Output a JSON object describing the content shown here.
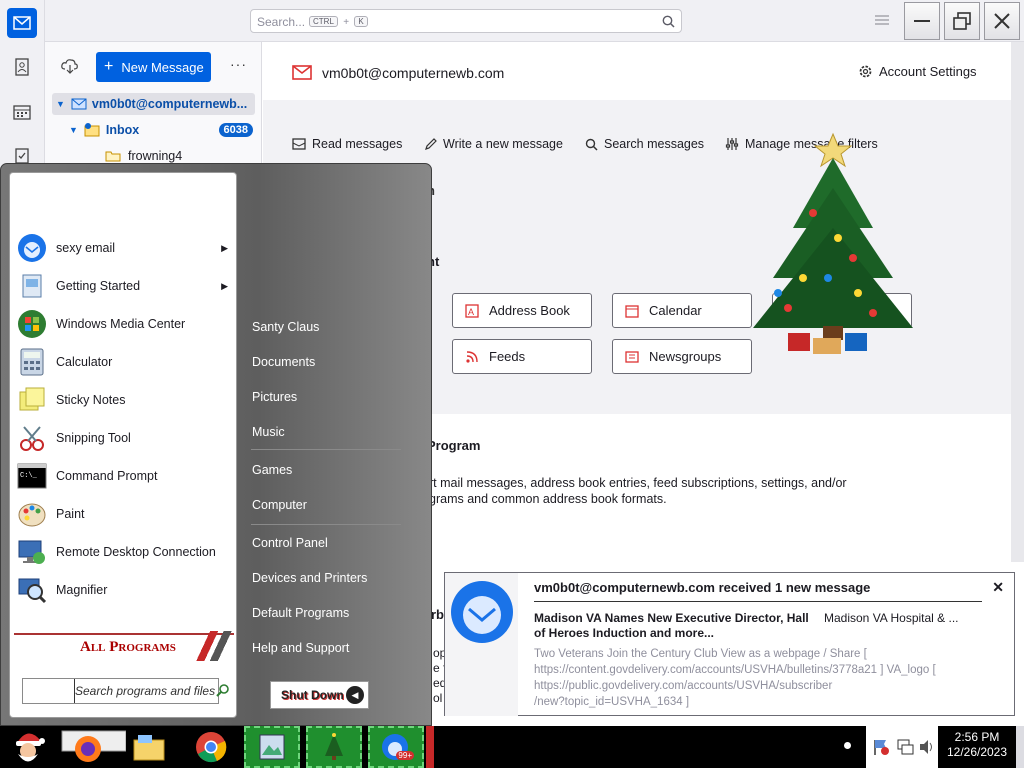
{
  "thunderbird": {
    "search": {
      "placeholder": "Search...",
      "shortcut_key1": "CTRL",
      "shortcut_plus": "+",
      "shortcut_key2": "K"
    },
    "new_message_label": "New Message",
    "account_name_short": "vm0b0t@computernewb...",
    "inbox_label": "Inbox",
    "inbox_count": "6038",
    "subfolder": "frowning4",
    "account_header": "vm0b0t@computernewb.com",
    "account_settings_label": "Account Settings",
    "actions": [
      "Read messages",
      "Write a new message",
      "Search messages",
      "Manage message filters"
    ],
    "section_accounts_tail": "nt",
    "apps": [
      "Address Book",
      "Calendar",
      "Feeds",
      "Newsgroups"
    ],
    "import_heading_tail": "Program",
    "import_text_line1": "rt mail messages, address book entries, feed subscriptions, settings, and/or",
    "import_text_line2": "grams and common address book formats.",
    "about_tail": "rb",
    "about_partial": [
      "op",
      "e f",
      "ed",
      "ol"
    ]
  },
  "start_menu": {
    "programs": [
      {
        "label": "sexy email",
        "icon": "thunderbird-icon",
        "submenu": true
      },
      {
        "label": "Getting Started",
        "icon": "getting-started-icon",
        "submenu": true
      },
      {
        "label": "Windows Media Center",
        "icon": "media-center-icon",
        "submenu": false
      },
      {
        "label": "Calculator",
        "icon": "calculator-icon",
        "submenu": false
      },
      {
        "label": "Sticky Notes",
        "icon": "sticky-notes-icon",
        "submenu": false
      },
      {
        "label": "Snipping Tool",
        "icon": "scissors-icon",
        "submenu": false
      },
      {
        "label": "Command Prompt",
        "icon": "cmd-icon",
        "submenu": false
      },
      {
        "label": "Paint",
        "icon": "paint-palette-icon",
        "submenu": false
      },
      {
        "label": "Remote Desktop Connection",
        "icon": "remote-desktop-icon",
        "submenu": false
      },
      {
        "label": "Magnifier",
        "icon": "magnifier-icon",
        "submenu": false
      }
    ],
    "all_programs_label": "All Programs",
    "search_placeholder": "Search programs and files",
    "right_items": [
      "Santy Claus",
      "Documents",
      "Pictures",
      "Music",
      "Games",
      "Computer",
      "Control Panel",
      "Devices and Printers",
      "Default Programs",
      "Help and Support"
    ],
    "shutdown_label": "Shut Down"
  },
  "notification": {
    "title": "vm0b0t@computernewb.com received 1 new message",
    "subject_line1": "Madison VA Names New Executive Director, Hall",
    "subject_line2": "of Heroes Induction and more...",
    "sender": "Madison VA Hospital & ...",
    "preview_line1": "Two Veterans Join the Century Club View as a webpage / Share [",
    "preview_line2": "https://content.govdelivery.com/accounts/USVHA/bulletins/3778a21 ] VA_logo [",
    "preview_line3": "https://public.govdelivery.com/accounts/USVHA/subscriber",
    "preview_line4": "/new?topic_id=USVHA_1634 ]"
  },
  "taskbar": {
    "time": "2:56 PM",
    "date": "12/26/2023",
    "badge": "99+"
  },
  "colors": {
    "accent": "#0061e0",
    "inbox_badge": "#0b63ce",
    "start_bg": "#666666",
    "taskbar_green": "#1f8f2e"
  }
}
